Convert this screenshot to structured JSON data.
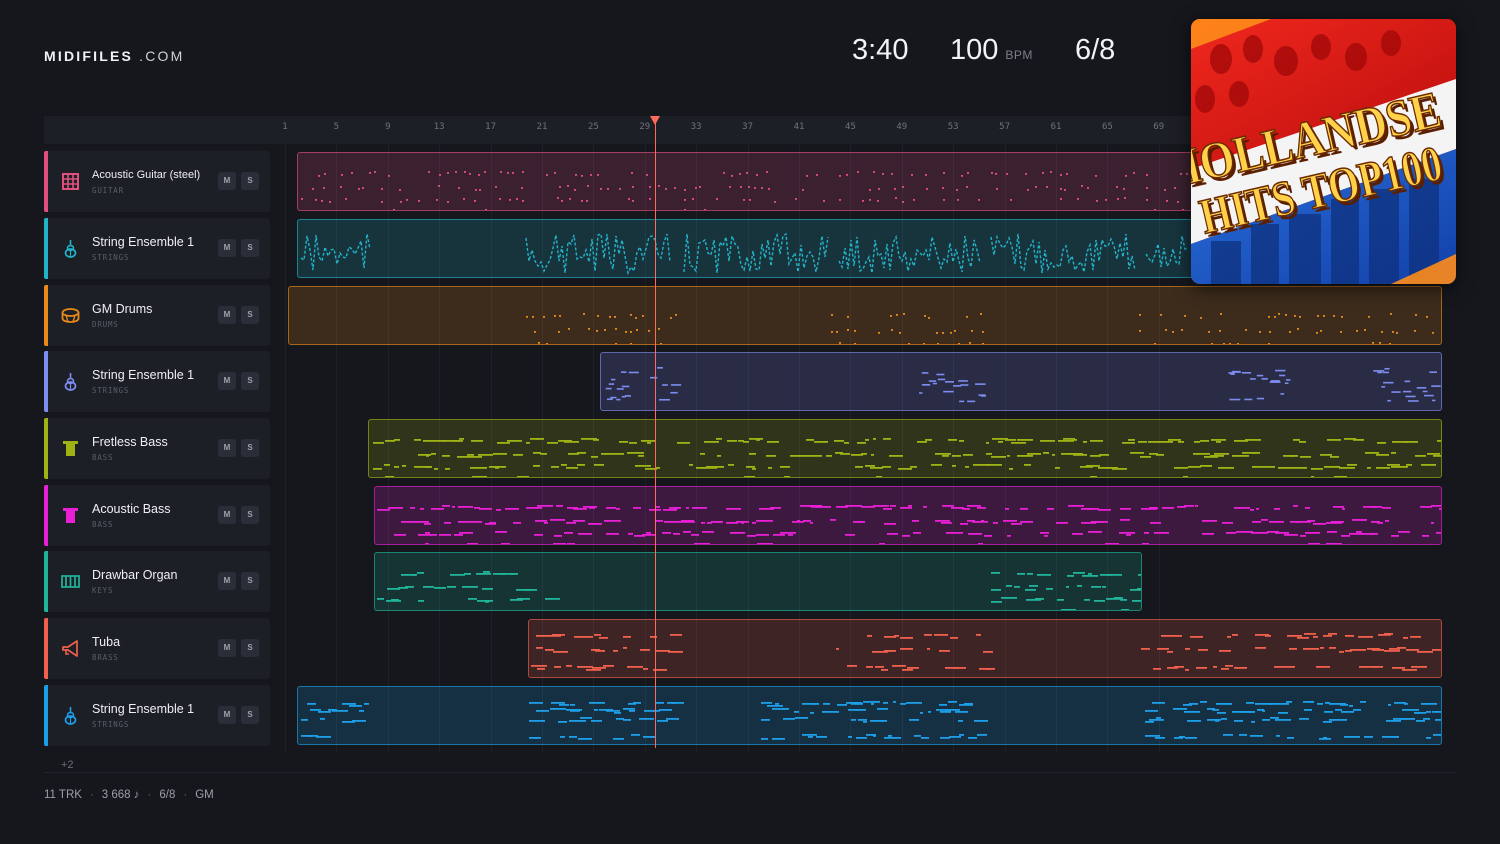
{
  "brand": {
    "name_bold": "MIDIFILES",
    "name_light": ".COM"
  },
  "stats": {
    "duration": "3:40",
    "tempo": "100",
    "tempo_unit": "BPM",
    "time_signature": "6/8"
  },
  "ruler": {
    "bars": [
      "1",
      "5",
      "9",
      "13",
      "17",
      "21",
      "25",
      "29",
      "33",
      "37",
      "41",
      "45",
      "49",
      "53",
      "57",
      "61",
      "65",
      "69"
    ]
  },
  "tracks": [
    {
      "name": "Acoustic Guitar (steel)",
      "category": "GUITAR",
      "color": "#e0507f",
      "icon": "guitar-icon",
      "mute": "M",
      "solo": "S"
    },
    {
      "name": "String Ensemble 1",
      "category": "STRINGS",
      "color": "#22b3c9",
      "icon": "violin-icon",
      "mute": "M",
      "solo": "S"
    },
    {
      "name": "GM Drums",
      "category": "DRUMS",
      "color": "#e8891c",
      "icon": "drum-icon",
      "mute": "M",
      "solo": "S"
    },
    {
      "name": "String Ensemble 1",
      "category": "STRINGS",
      "color": "#7d8cf0",
      "icon": "violin-icon",
      "mute": "M",
      "solo": "S"
    },
    {
      "name": "Fretless Bass",
      "category": "BASS",
      "color": "#9fb315",
      "icon": "bass-icon",
      "mute": "M",
      "solo": "S"
    },
    {
      "name": "Acoustic Bass",
      "category": "BASS",
      "color": "#e91fd6",
      "icon": "bass-icon",
      "mute": "M",
      "solo": "S"
    },
    {
      "name": "Drawbar Organ",
      "category": "KEYS",
      "color": "#20b49a",
      "icon": "keyboard-icon",
      "mute": "M",
      "solo": "S"
    },
    {
      "name": "Tuba",
      "category": "BRASS",
      "color": "#f0604c",
      "icon": "horn-icon",
      "mute": "M",
      "solo": "S"
    },
    {
      "name": "String Ensemble 1",
      "category": "STRINGS",
      "color": "#1d9ee8",
      "icon": "violin-icon",
      "mute": "M",
      "solo": "S"
    }
  ],
  "more_tracks": "+2",
  "footer": {
    "tracks": "11 TRK",
    "notes": "3 668 ♪",
    "time_signature": "6/8",
    "standard": "GM"
  },
  "album": {
    "line1": "HOLLANDSE",
    "line2": "HITS TOP100"
  }
}
